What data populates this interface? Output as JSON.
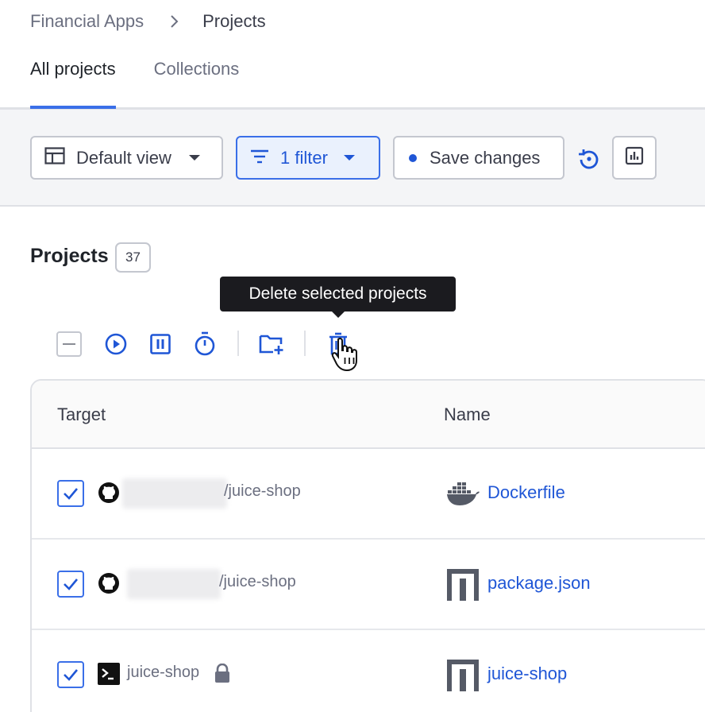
{
  "breadcrumb": {
    "parent": "Financial Apps",
    "current": "Projects"
  },
  "tabs": [
    {
      "label": "All projects",
      "active": true
    },
    {
      "label": "Collections",
      "active": false
    }
  ],
  "toolbar": {
    "view_label": "Default view",
    "filter_label": "1 filter",
    "save_label": "Save changes"
  },
  "projects": {
    "title": "Projects",
    "count": "37"
  },
  "tooltip": {
    "text": "Delete selected projects"
  },
  "table": {
    "columns": [
      "Target",
      "Name"
    ],
    "rows": [
      {
        "target": "/juice-shop",
        "target_icon": "github-icon",
        "name": "Dockerfile",
        "name_icon": "docker-icon",
        "checked": true
      },
      {
        "target": "/juice-shop",
        "target_icon": "github-icon",
        "name": "package.json",
        "name_icon": "npm-icon",
        "checked": true
      },
      {
        "target": "juice-shop",
        "target_icon": "terminal-icon",
        "name": "juice-shop",
        "name_icon": "npm-icon",
        "checked": true,
        "locked": true
      }
    ]
  },
  "colors": {
    "accent": "#1f56d6",
    "border": "#c4c7cf",
    "tooltip_bg": "#1b1b1f"
  }
}
